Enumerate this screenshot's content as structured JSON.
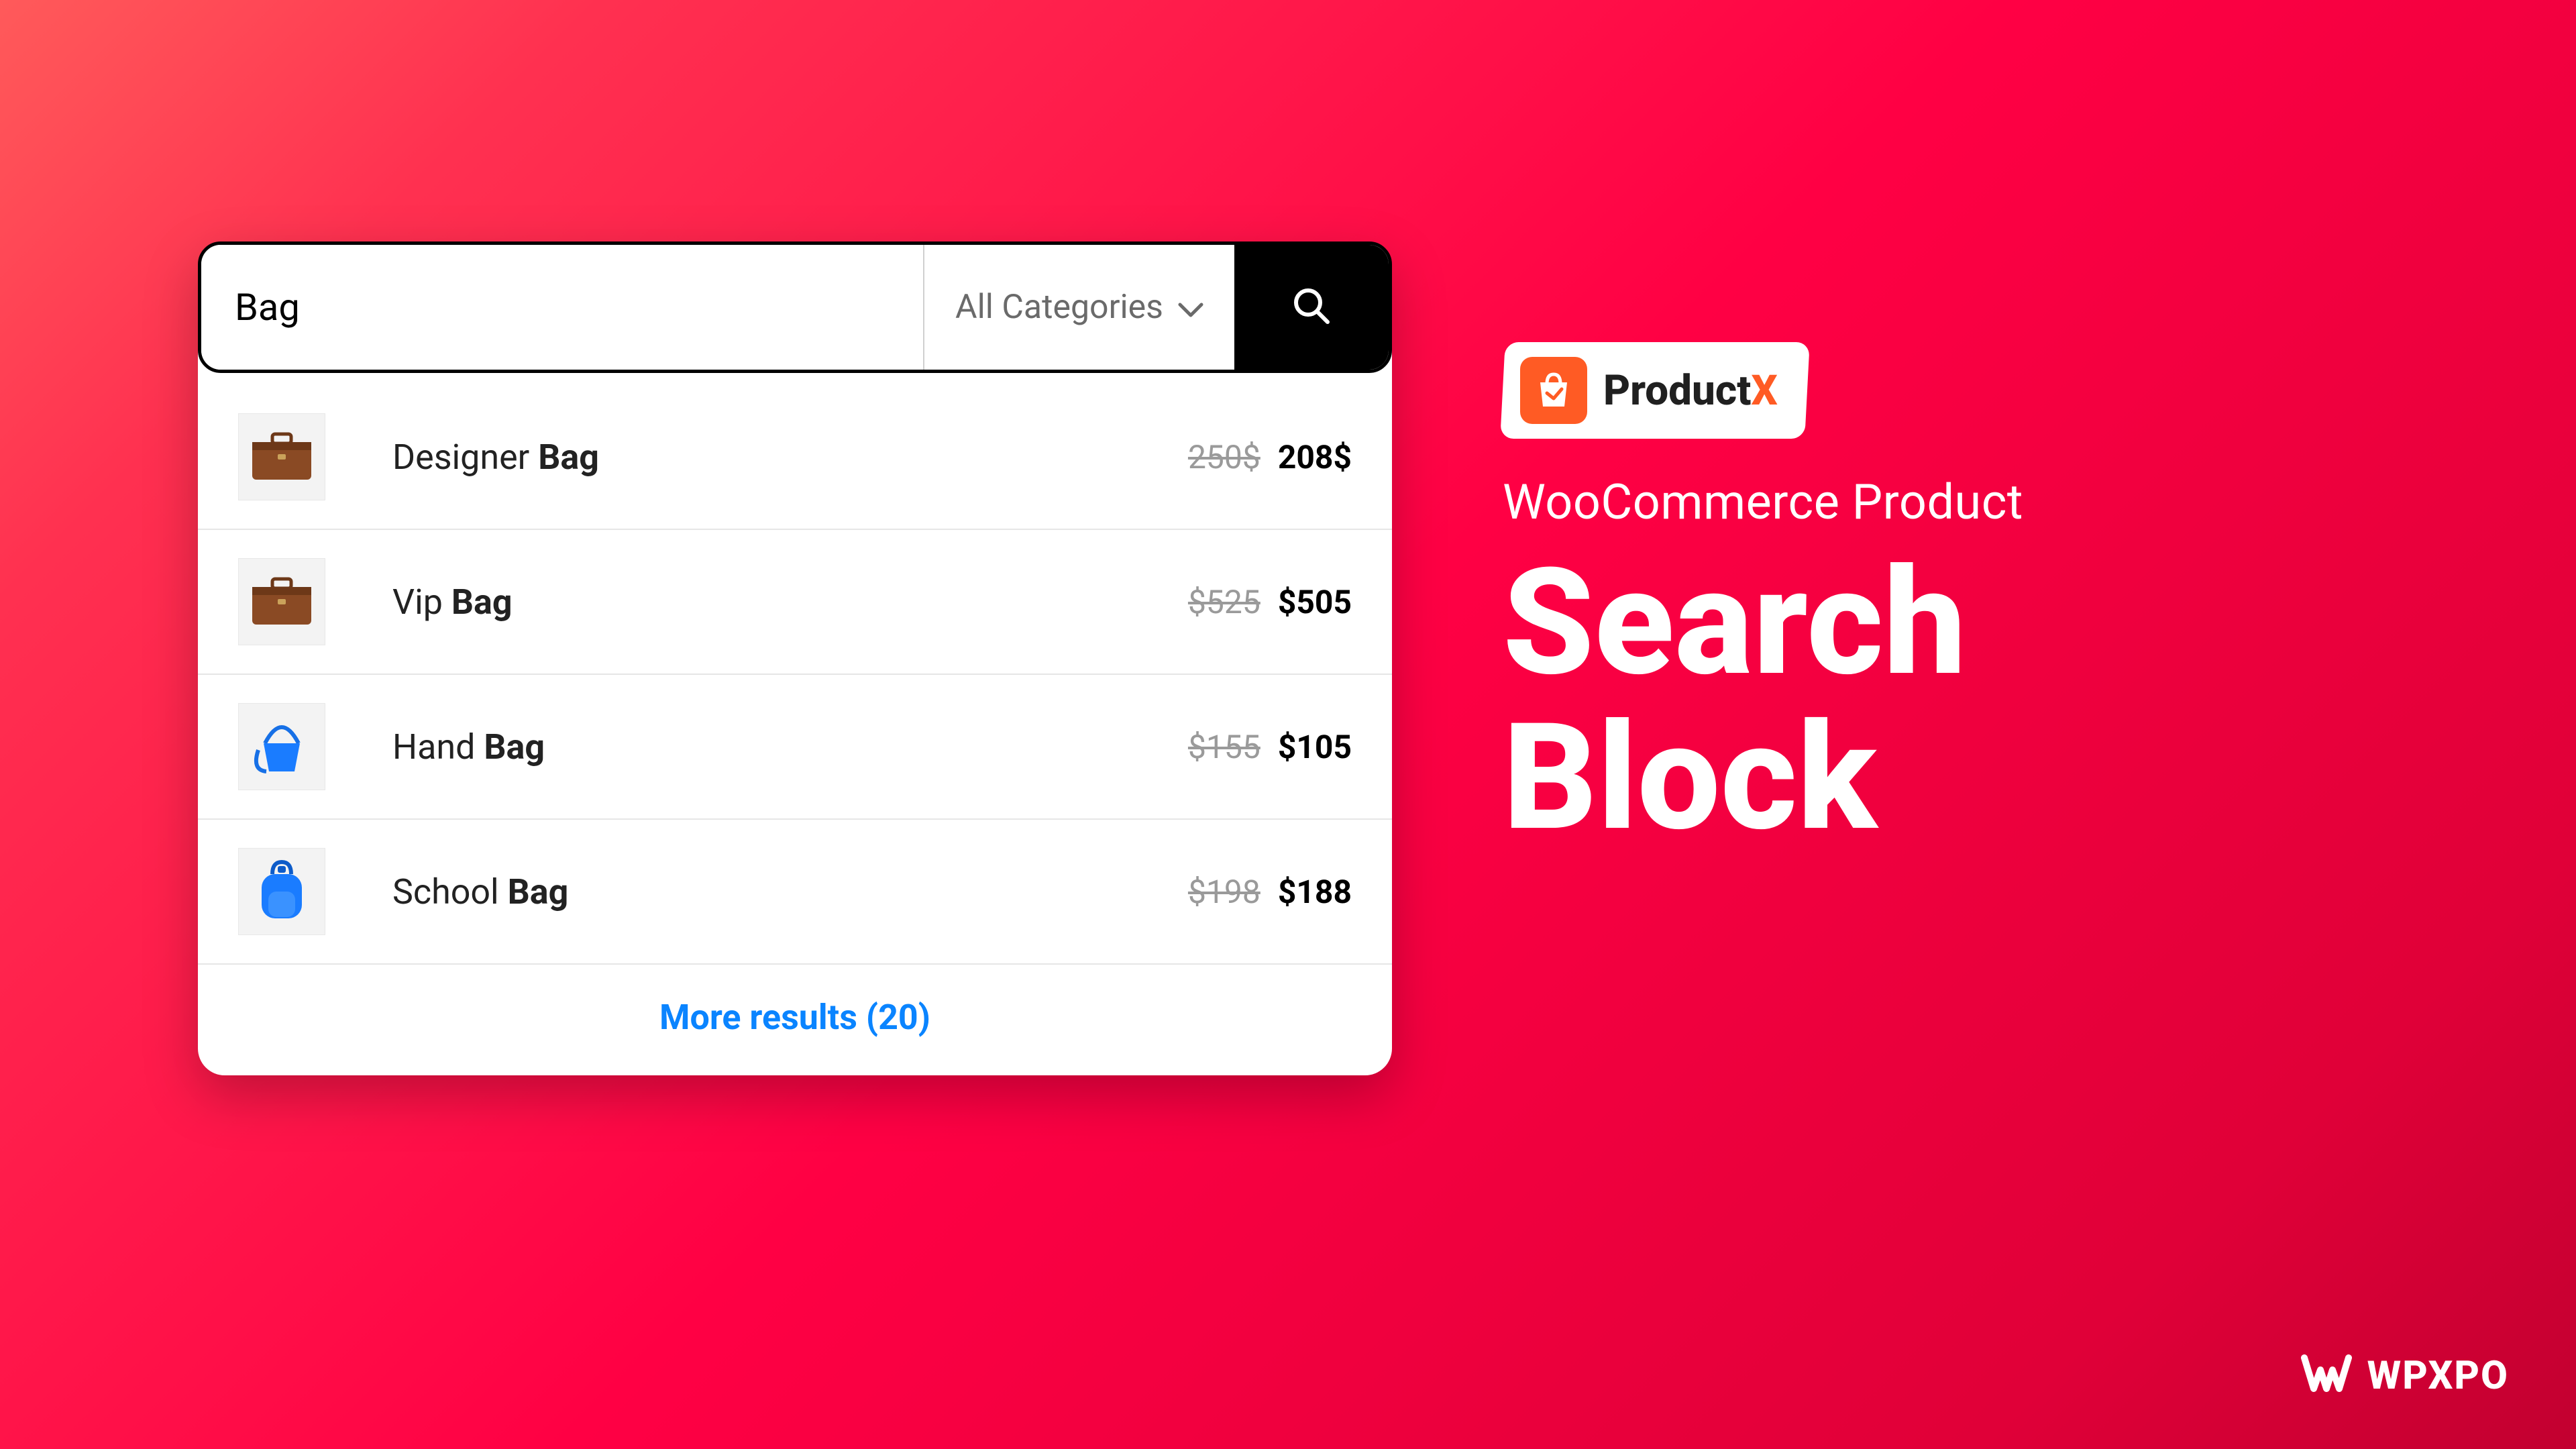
{
  "search": {
    "query": "Bag",
    "category_label": "All Categories",
    "more_label": "More results (20)"
  },
  "results": [
    {
      "name_prefix": "Designer ",
      "name_match": "Bag",
      "old_price": "250$",
      "new_price": "208$",
      "icon": "briefcase-brown"
    },
    {
      "name_prefix": "Vip ",
      "name_match": "Bag",
      "old_price": "$525",
      "new_price": "$505",
      "icon": "briefcase-brown"
    },
    {
      "name_prefix": "Hand ",
      "name_match": "Bag",
      "old_price": "$155",
      "new_price": "$105",
      "icon": "handbag-blue"
    },
    {
      "name_prefix": "School ",
      "name_match": "Bag",
      "old_price": "$198",
      "new_price": "$188",
      "icon": "backpack-blue"
    }
  ],
  "branding": {
    "badge_name": "Product",
    "badge_suffix": "X",
    "subtitle": "WooCommerce Product",
    "title_line1": "Search",
    "title_line2": "Block",
    "footer": "WPXPO"
  }
}
